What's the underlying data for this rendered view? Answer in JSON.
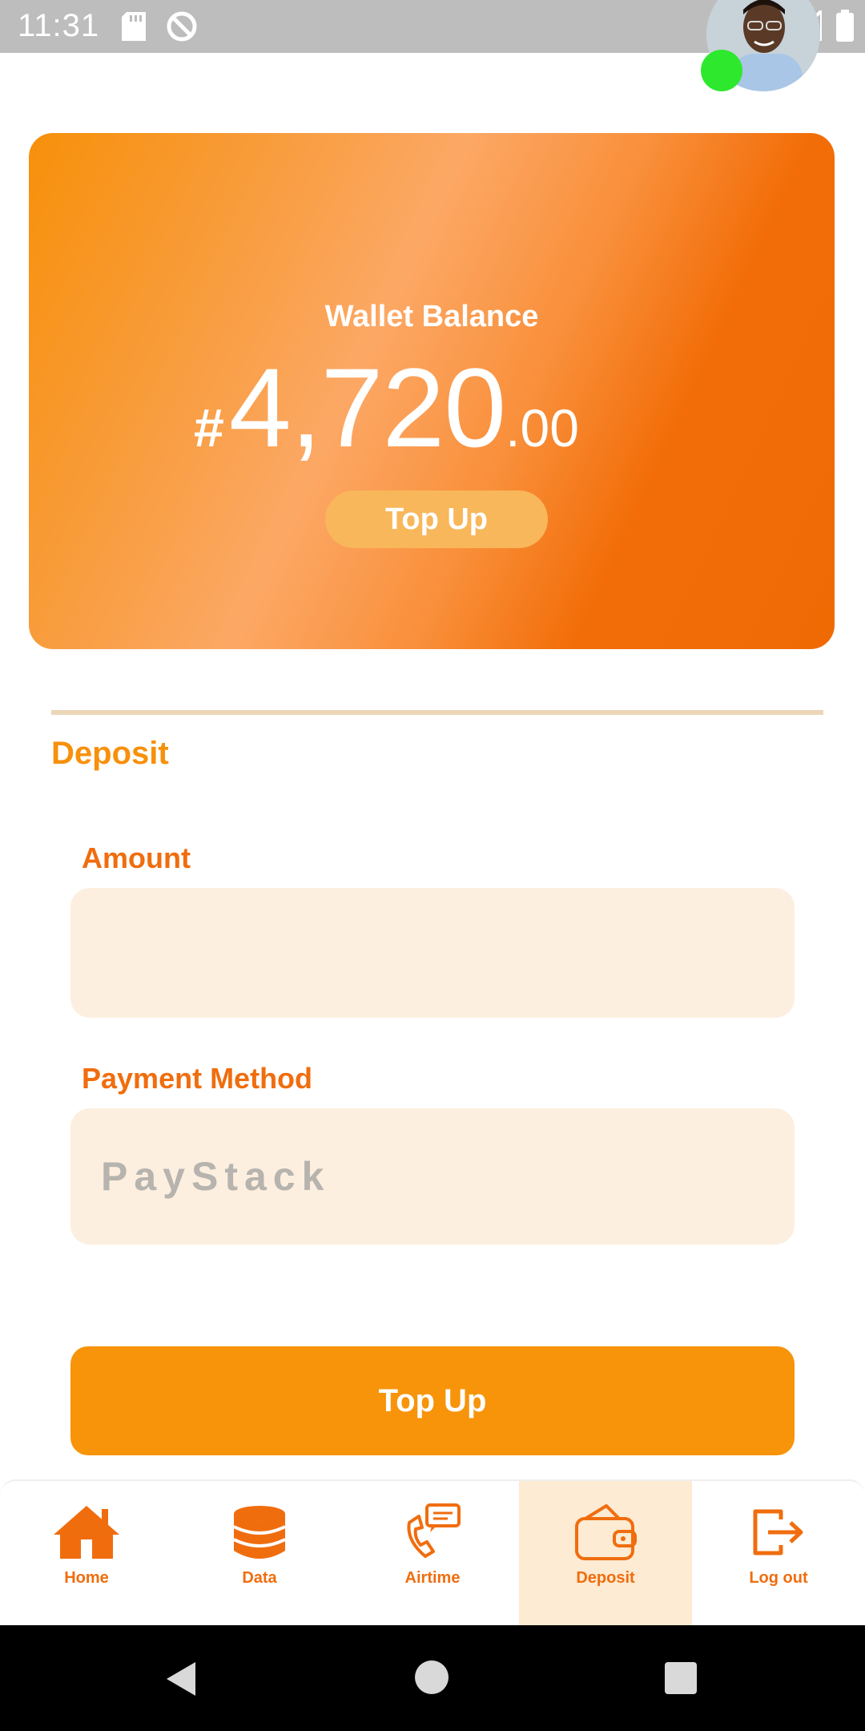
{
  "status_bar": {
    "time": "11:31",
    "icons": [
      "sd-card-icon",
      "sync-icon",
      "wifi-icon",
      "signal-icon",
      "battery-icon"
    ]
  },
  "profile": {
    "avatar": "avatar",
    "online_status_color": "#2ee82e"
  },
  "wallet": {
    "label": "Wallet Balance",
    "currency": "#",
    "amount_main": "4,720",
    "amount_decimal": ".00",
    "top_up_label": "Top Up"
  },
  "deposit": {
    "section_title": "Deposit",
    "amount_label": "Amount",
    "amount_value": "",
    "payment_method_label": "Payment Method",
    "payment_method_value": "PayStack",
    "submit_label": "Top Up"
  },
  "bottom_nav": {
    "items": [
      {
        "label": "Home",
        "icon": "home-icon",
        "active": false
      },
      {
        "label": "Data",
        "icon": "database-icon",
        "active": false
      },
      {
        "label": "Airtime",
        "icon": "phone-chat-icon",
        "active": false
      },
      {
        "label": "Deposit",
        "icon": "wallet-icon",
        "active": true
      },
      {
        "label": "Log out",
        "icon": "logout-icon",
        "active": false
      }
    ]
  },
  "colors": {
    "accent": "#f7900a",
    "accent_dark": "#f06d0e",
    "field_bg": "#fdefdf",
    "active_nav_bg": "#fdebd3"
  }
}
